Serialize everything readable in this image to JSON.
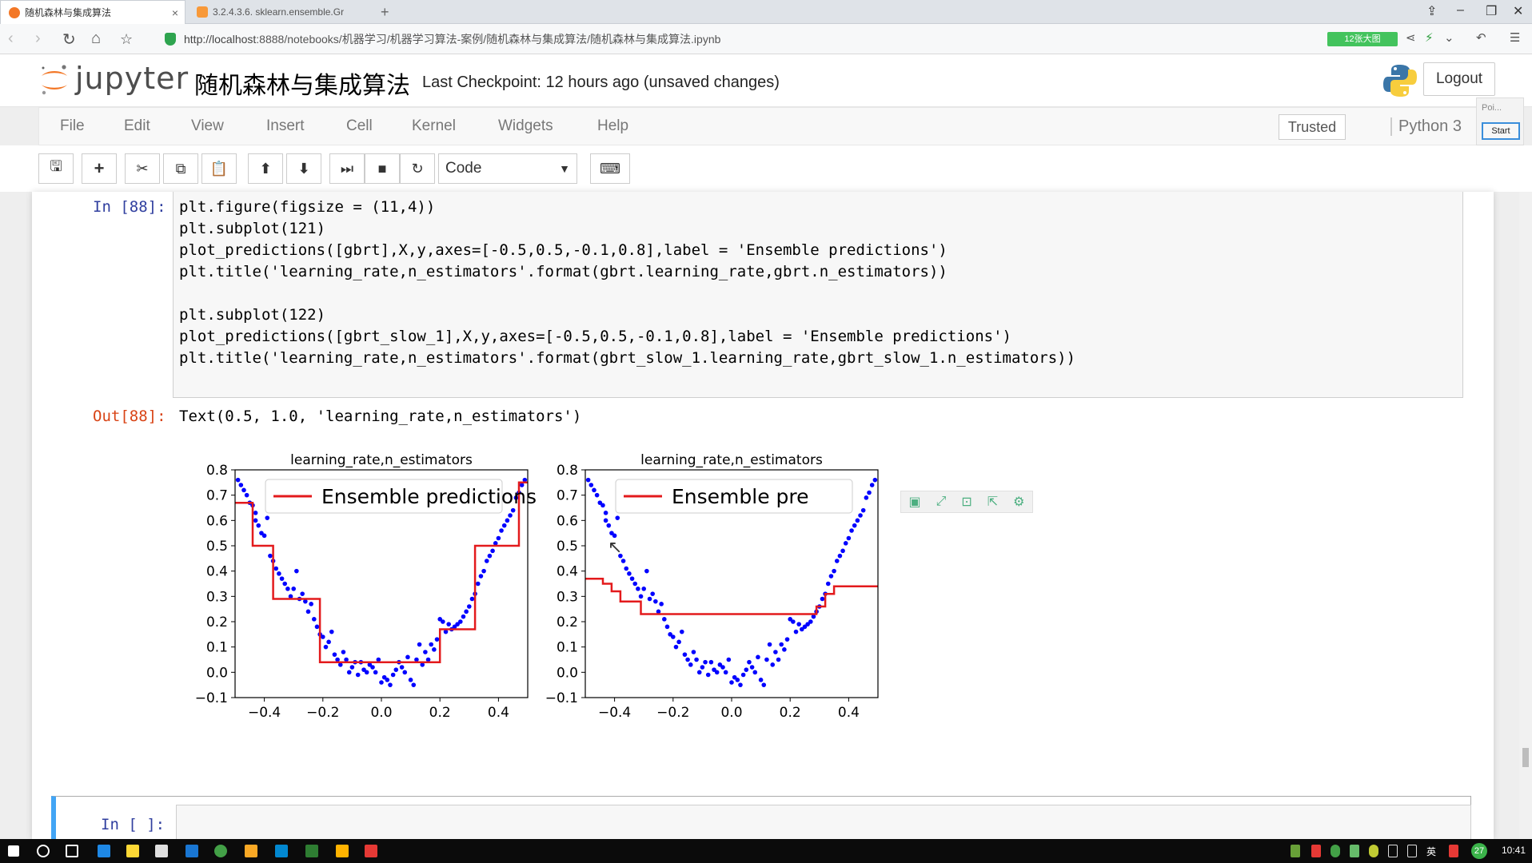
{
  "browser": {
    "tabs": [
      {
        "label": "随机森林与集成算法",
        "active": true
      },
      {
        "label": "3.2.4.3.6. sklearn.ensemble.Gr",
        "active": false
      }
    ],
    "new_tab": "+",
    "url_host": "http://localhost",
    "url_rest": ":8888/notebooks/机器学习/机器学习算法-案例/随机森林与集成算法/随机森林与集成算法.ipynb",
    "badge": "12张大图"
  },
  "header": {
    "logo_word": "jupyter",
    "notebook_title": "随机森林与集成算法",
    "checkpoint": "Last Checkpoint: 12 hours ago (unsaved changes)",
    "logout": "Logout"
  },
  "menubar": {
    "items": [
      "File",
      "Edit",
      "View",
      "Insert",
      "Cell",
      "Kernel",
      "Widgets",
      "Help"
    ],
    "trusted": "Trusted",
    "kernel": "Python 3",
    "popover_title": "Poi...",
    "popover_start": "Start"
  },
  "toolbar": {
    "cell_type": "Code"
  },
  "cell_in": {
    "prompt": "In [88]:",
    "lines": [
      "plt.figure(figsize = (11,4))",
      "plt.subplot(121)",
      "plot_predictions([gbrt],X,y,axes=[-0.5,0.5,-0.1,0.8],label = 'Ensemble predictions')",
      "plt.title('learning_rate,n_estimators'.format(gbrt.learning_rate,gbrt.n_estimators))",
      "",
      "plt.subplot(122)",
      "plot_predictions([gbrt_slow_1],X,y,axes=[-0.5,0.5,-0.1,0.8],label = 'Ensemble predictions')",
      "plt.title('learning_rate,n_estimators'.format(gbrt_slow_1.learning_rate,gbrt_slow_1.n_estimators))"
    ]
  },
  "cell_out": {
    "prompt": "Out[88]:",
    "text": "Text(0.5, 1.0, 'learning_rate,n_estimators')"
  },
  "empty_cell": {
    "prompt": "In [ ]:"
  },
  "taskbar": {
    "clock": "10:41",
    "badge": "27"
  },
  "chart_data": [
    {
      "type": "scatter",
      "title": "learning_rate,n_estimators",
      "xlim": [
        -0.5,
        0.5
      ],
      "ylim": [
        -0.1,
        0.8
      ],
      "xticks": [
        "−0.4",
        "−0.2",
        "0.0",
        "0.2",
        "0.4"
      ],
      "yticks": [
        "−0.1",
        "0.0",
        "0.1",
        "0.2",
        "0.3",
        "0.4",
        "0.5",
        "0.6",
        "0.7",
        "0.8"
      ],
      "legend": "Ensemble predictions",
      "legend_position": "top",
      "points_color": "#0000ff",
      "line_color": "#e31a1c",
      "points": [
        [
          -0.49,
          0.76
        ],
        [
          -0.48,
          0.74
        ],
        [
          -0.47,
          0.72
        ],
        [
          -0.46,
          0.7
        ],
        [
          -0.45,
          0.67
        ],
        [
          -0.44,
          0.66
        ],
        [
          -0.43,
          0.63
        ],
        [
          -0.43,
          0.6
        ],
        [
          -0.42,
          0.58
        ],
        [
          -0.41,
          0.55
        ],
        [
          -0.4,
          0.54
        ],
        [
          -0.39,
          0.61
        ],
        [
          -0.38,
          0.46
        ],
        [
          -0.37,
          0.44
        ],
        [
          -0.36,
          0.41
        ],
        [
          -0.35,
          0.39
        ],
        [
          -0.34,
          0.37
        ],
        [
          -0.33,
          0.35
        ],
        [
          -0.32,
          0.33
        ],
        [
          -0.31,
          0.3
        ],
        [
          -0.3,
          0.33
        ],
        [
          -0.29,
          0.4
        ],
        [
          -0.28,
          0.29
        ],
        [
          -0.27,
          0.31
        ],
        [
          -0.26,
          0.28
        ],
        [
          -0.25,
          0.24
        ],
        [
          -0.24,
          0.27
        ],
        [
          -0.23,
          0.21
        ],
        [
          -0.22,
          0.18
        ],
        [
          -0.21,
          0.15
        ],
        [
          -0.2,
          0.14
        ],
        [
          -0.19,
          0.1
        ],
        [
          -0.18,
          0.12
        ],
        [
          -0.17,
          0.16
        ],
        [
          -0.16,
          0.07
        ],
        [
          -0.15,
          0.05
        ],
        [
          -0.14,
          0.03
        ],
        [
          -0.13,
          0.08
        ],
        [
          -0.12,
          0.05
        ],
        [
          -0.11,
          0.0
        ],
        [
          -0.1,
          0.02
        ],
        [
          -0.09,
          0.04
        ],
        [
          -0.08,
          -0.01
        ],
        [
          -0.07,
          0.04
        ],
        [
          -0.06,
          0.01
        ],
        [
          -0.05,
          0.0
        ],
        [
          -0.04,
          0.03
        ],
        [
          -0.03,
          0.02
        ],
        [
          -0.02,
          0.0
        ],
        [
          -0.01,
          0.05
        ],
        [
          0.0,
          -0.04
        ],
        [
          0.01,
          -0.02
        ],
        [
          0.02,
          -0.03
        ],
        [
          0.03,
          -0.05
        ],
        [
          0.04,
          -0.01
        ],
        [
          0.05,
          0.01
        ],
        [
          0.06,
          0.04
        ],
        [
          0.07,
          0.02
        ],
        [
          0.08,
          0.0
        ],
        [
          0.09,
          0.06
        ],
        [
          0.1,
          -0.03
        ],
        [
          0.11,
          -0.05
        ],
        [
          0.12,
          0.05
        ],
        [
          0.13,
          0.11
        ],
        [
          0.14,
          0.03
        ],
        [
          0.15,
          0.08
        ],
        [
          0.16,
          0.05
        ],
        [
          0.17,
          0.11
        ],
        [
          0.18,
          0.09
        ],
        [
          0.19,
          0.13
        ],
        [
          0.2,
          0.21
        ],
        [
          0.21,
          0.2
        ],
        [
          0.22,
          0.16
        ],
        [
          0.23,
          0.19
        ],
        [
          0.24,
          0.17
        ],
        [
          0.25,
          0.18
        ],
        [
          0.26,
          0.19
        ],
        [
          0.27,
          0.2
        ],
        [
          0.28,
          0.22
        ],
        [
          0.29,
          0.24
        ],
        [
          0.3,
          0.26
        ],
        [
          0.31,
          0.29
        ],
        [
          0.32,
          0.31
        ],
        [
          0.33,
          0.35
        ],
        [
          0.34,
          0.38
        ],
        [
          0.35,
          0.4
        ],
        [
          0.36,
          0.44
        ],
        [
          0.37,
          0.46
        ],
        [
          0.38,
          0.48
        ],
        [
          0.39,
          0.51
        ],
        [
          0.4,
          0.53
        ],
        [
          0.41,
          0.56
        ],
        [
          0.42,
          0.58
        ],
        [
          0.43,
          0.6
        ],
        [
          0.44,
          0.62
        ],
        [
          0.45,
          0.64
        ],
        [
          0.46,
          0.69
        ],
        [
          0.47,
          0.71
        ],
        [
          0.48,
          0.74
        ],
        [
          0.49,
          0.76
        ]
      ],
      "prediction": [
        [
          -0.5,
          0.67
        ],
        [
          -0.44,
          0.67
        ],
        [
          -0.44,
          0.5
        ],
        [
          -0.37,
          0.5
        ],
        [
          -0.37,
          0.29
        ],
        [
          -0.21,
          0.29
        ],
        [
          -0.21,
          0.04
        ],
        [
          0.2,
          0.04
        ],
        [
          0.2,
          0.17
        ],
        [
          0.32,
          0.17
        ],
        [
          0.32,
          0.5
        ],
        [
          0.47,
          0.5
        ],
        [
          0.47,
          0.75
        ],
        [
          0.5,
          0.75
        ]
      ]
    },
    {
      "type": "scatter",
      "title": "learning_rate,n_estimators",
      "xlim": [
        -0.5,
        0.5
      ],
      "ylim": [
        -0.1,
        0.8
      ],
      "xticks": [
        "−0.4",
        "−0.2",
        "0.0",
        "0.2",
        "0.4"
      ],
      "yticks": [
        "−0.1",
        "0.0",
        "0.1",
        "0.2",
        "0.3",
        "0.4",
        "0.5",
        "0.6",
        "0.7",
        "0.8"
      ],
      "legend": "Ensemble pre",
      "legend_position": "top",
      "points_color": "#0000ff",
      "line_color": "#e31a1c",
      "points": [
        [
          -0.49,
          0.76
        ],
        [
          -0.48,
          0.74
        ],
        [
          -0.47,
          0.72
        ],
        [
          -0.46,
          0.7
        ],
        [
          -0.45,
          0.67
        ],
        [
          -0.44,
          0.66
        ],
        [
          -0.43,
          0.63
        ],
        [
          -0.43,
          0.6
        ],
        [
          -0.42,
          0.58
        ],
        [
          -0.41,
          0.55
        ],
        [
          -0.4,
          0.54
        ],
        [
          -0.39,
          0.61
        ],
        [
          -0.38,
          0.46
        ],
        [
          -0.37,
          0.44
        ],
        [
          -0.36,
          0.41
        ],
        [
          -0.35,
          0.39
        ],
        [
          -0.34,
          0.37
        ],
        [
          -0.33,
          0.35
        ],
        [
          -0.32,
          0.33
        ],
        [
          -0.31,
          0.3
        ],
        [
          -0.3,
          0.33
        ],
        [
          -0.29,
          0.4
        ],
        [
          -0.28,
          0.29
        ],
        [
          -0.27,
          0.31
        ],
        [
          -0.26,
          0.28
        ],
        [
          -0.25,
          0.24
        ],
        [
          -0.24,
          0.27
        ],
        [
          -0.23,
          0.21
        ],
        [
          -0.22,
          0.18
        ],
        [
          -0.21,
          0.15
        ],
        [
          -0.2,
          0.14
        ],
        [
          -0.19,
          0.1
        ],
        [
          -0.18,
          0.12
        ],
        [
          -0.17,
          0.16
        ],
        [
          -0.16,
          0.07
        ],
        [
          -0.15,
          0.05
        ],
        [
          -0.14,
          0.03
        ],
        [
          -0.13,
          0.08
        ],
        [
          -0.12,
          0.05
        ],
        [
          -0.11,
          0.0
        ],
        [
          -0.1,
          0.02
        ],
        [
          -0.09,
          0.04
        ],
        [
          -0.08,
          -0.01
        ],
        [
          -0.07,
          0.04
        ],
        [
          -0.06,
          0.01
        ],
        [
          -0.05,
          0.0
        ],
        [
          -0.04,
          0.03
        ],
        [
          -0.03,
          0.02
        ],
        [
          -0.02,
          0.0
        ],
        [
          -0.01,
          0.05
        ],
        [
          0.0,
          -0.04
        ],
        [
          0.01,
          -0.02
        ],
        [
          0.02,
          -0.03
        ],
        [
          0.03,
          -0.05
        ],
        [
          0.04,
          -0.01
        ],
        [
          0.05,
          0.01
        ],
        [
          0.06,
          0.04
        ],
        [
          0.07,
          0.02
        ],
        [
          0.08,
          0.0
        ],
        [
          0.09,
          0.06
        ],
        [
          0.1,
          -0.03
        ],
        [
          0.11,
          -0.05
        ],
        [
          0.12,
          0.05
        ],
        [
          0.13,
          0.11
        ],
        [
          0.14,
          0.03
        ],
        [
          0.15,
          0.08
        ],
        [
          0.16,
          0.05
        ],
        [
          0.17,
          0.11
        ],
        [
          0.18,
          0.09
        ],
        [
          0.19,
          0.13
        ],
        [
          0.2,
          0.21
        ],
        [
          0.21,
          0.2
        ],
        [
          0.22,
          0.16
        ],
        [
          0.23,
          0.19
        ],
        [
          0.24,
          0.17
        ],
        [
          0.25,
          0.18
        ],
        [
          0.26,
          0.19
        ],
        [
          0.27,
          0.2
        ],
        [
          0.28,
          0.22
        ],
        [
          0.29,
          0.24
        ],
        [
          0.3,
          0.26
        ],
        [
          0.31,
          0.29
        ],
        [
          0.32,
          0.31
        ],
        [
          0.33,
          0.35
        ],
        [
          0.34,
          0.38
        ],
        [
          0.35,
          0.4
        ],
        [
          0.36,
          0.44
        ],
        [
          0.37,
          0.46
        ],
        [
          0.38,
          0.48
        ],
        [
          0.39,
          0.51
        ],
        [
          0.4,
          0.53
        ],
        [
          0.41,
          0.56
        ],
        [
          0.42,
          0.58
        ],
        [
          0.43,
          0.6
        ],
        [
          0.44,
          0.62
        ],
        [
          0.45,
          0.64
        ],
        [
          0.46,
          0.69
        ],
        [
          0.47,
          0.71
        ],
        [
          0.48,
          0.74
        ],
        [
          0.49,
          0.76
        ]
      ],
      "prediction": [
        [
          -0.5,
          0.37
        ],
        [
          -0.44,
          0.37
        ],
        [
          -0.44,
          0.35
        ],
        [
          -0.41,
          0.35
        ],
        [
          -0.41,
          0.32
        ],
        [
          -0.38,
          0.32
        ],
        [
          -0.38,
          0.28
        ],
        [
          -0.31,
          0.28
        ],
        [
          -0.31,
          0.23
        ],
        [
          0.29,
          0.23
        ],
        [
          0.29,
          0.26
        ],
        [
          0.32,
          0.26
        ],
        [
          0.32,
          0.31
        ],
        [
          0.35,
          0.31
        ],
        [
          0.35,
          0.34
        ],
        [
          0.5,
          0.34
        ]
      ]
    }
  ]
}
